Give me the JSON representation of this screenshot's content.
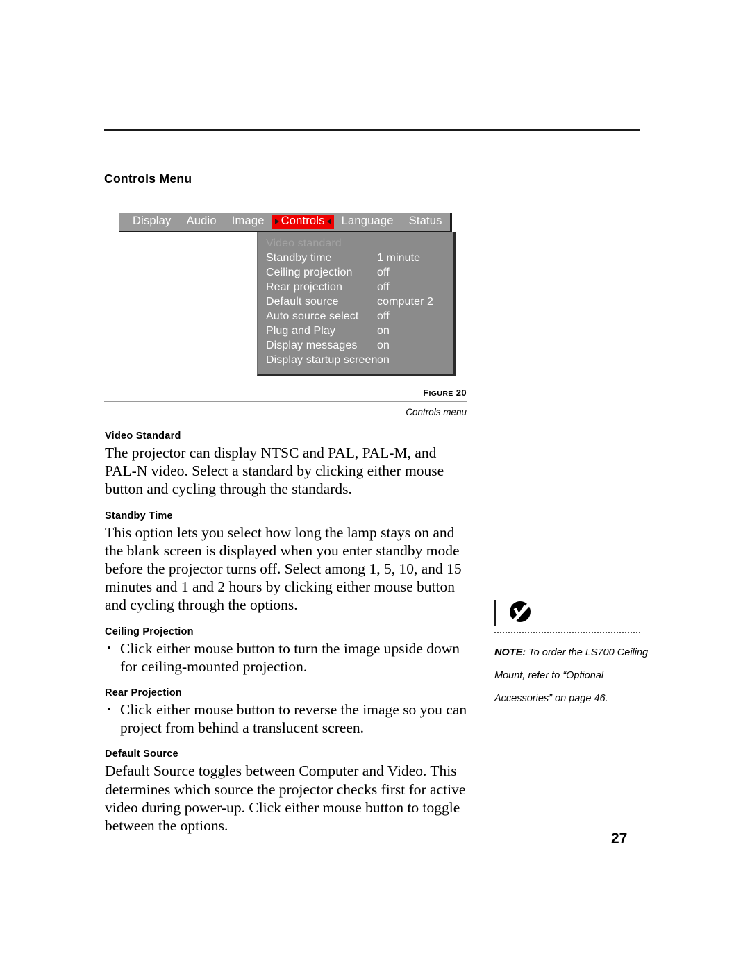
{
  "page": {
    "number": "27",
    "section_title": "Controls Menu"
  },
  "osd": {
    "menubar": [
      {
        "label": "Display",
        "active": false
      },
      {
        "label": "Audio",
        "active": false
      },
      {
        "label": "Image",
        "active": false
      },
      {
        "label": "Controls",
        "active": true
      },
      {
        "label": "Language",
        "active": false
      },
      {
        "label": "Status",
        "active": false
      }
    ],
    "active_tab_color": "#ee0000",
    "menubar_bg": "#9b9b9b",
    "dropdown_bg": "#8b8b8b",
    "dropdown": [
      {
        "label": "Video standard",
        "value": "",
        "disabled": true
      },
      {
        "label": "Standby time",
        "value": "1 minute",
        "disabled": false
      },
      {
        "label": "Ceiling projection",
        "value": "off",
        "disabled": false
      },
      {
        "label": "Rear projection",
        "value": "off",
        "disabled": false
      },
      {
        "label": "Default source",
        "value": "computer 2",
        "disabled": false
      },
      {
        "label": "Auto source select",
        "value": "off",
        "disabled": false
      },
      {
        "label": "Plug and Play",
        "value": "on",
        "disabled": false
      },
      {
        "label": "Display messages",
        "value": "on",
        "disabled": false
      },
      {
        "label": "Display startup screen",
        "value": "on",
        "disabled": false
      }
    ]
  },
  "figure": {
    "label_prefix": "F",
    "label_rest": "IGURE",
    "label_full": "FIGURE 20",
    "number": "20",
    "caption": "Controls menu"
  },
  "body": {
    "video_standard": {
      "heading": "Video Standard",
      "paragraph": "The projector can display NTSC and PAL, PAL-M, and PAL-N video. Select a standard by clicking either mouse button and cycling through the standards."
    },
    "standby_time": {
      "heading": "Standby Time",
      "paragraph": "This option lets you select how long the lamp stays on and the blank screen is displayed when you enter standby mode before the projector turns off. Select among 1, 5, 10, and 15 minutes and 1 and 2 hours by clicking either mouse button and cycling through the options."
    },
    "ceiling_projection": {
      "heading": "Ceiling Projection",
      "bullet": "Click either mouse button to turn the image upside down for ceiling-mounted projection."
    },
    "rear_projection": {
      "heading": "Rear Projection",
      "bullet": "Click either mouse button to reverse the image so you can project from behind a translucent screen."
    },
    "default_source": {
      "heading": "Default Source",
      "paragraph": "Default Source toggles between Computer and Video. This determines which source the projector checks first for active video during power-up. Click either mouse button to toggle between the options."
    }
  },
  "note": {
    "prefix": "NOTE:",
    "text": " To order the LS700 Ceiling Mount, refer to “Optional Accessories” on page 46."
  }
}
